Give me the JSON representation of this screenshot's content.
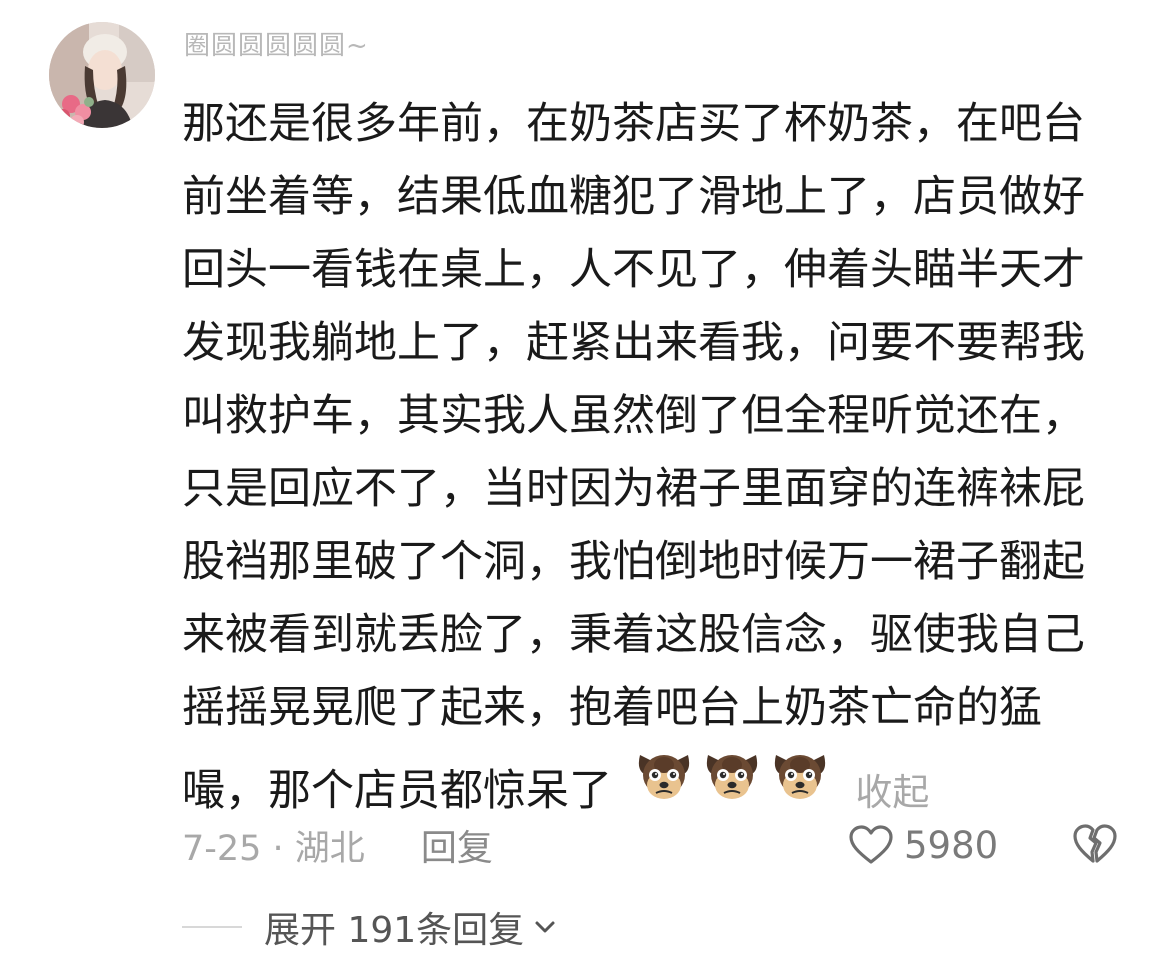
{
  "comment": {
    "username": "圈圆圆圆圆圆~",
    "text_lines": [
      "那还是很多年前，在奶茶店买了杯奶茶，在吧台",
      "前坐着等，结果低血糖犯了滑地上了，店员做好",
      "回头一看钱在桌上，人不见了，伸着头瞄半天才",
      "发现我躺地上了，赶紧出来看我，问要不要帮我",
      "叫救护车，其实我人虽然倒了但全程听觉还在，",
      "只是回应不了，当时因为裙子里面穿的连裤袜屁",
      "股裆那里破了个洞，我怕倒地时候万一裙子翻起",
      "来被看到就丢脸了，秉着这股信念，驱使我自己",
      "摇摇晃晃爬了起来，抱着吧台上奶茶亡命的猛"
    ],
    "last_line": "嘬，那个店员都惊呆了",
    "emojis": [
      "dog-face-emoji",
      "dog-face-emoji",
      "dog-face-emoji"
    ],
    "collapse_label": "收起",
    "date_location": "7-25 · 湖北",
    "reply_label": "回复",
    "like_count": "5980",
    "expand_label": "展开 191条回复"
  },
  "icons": {
    "like": "heart-outline-icon",
    "dislike": "broken-heart-icon",
    "expand": "chevron-down-icon"
  },
  "colors": {
    "text": "#1a1a1a",
    "secondary": "#a8a8a8",
    "background": "#ffffff"
  }
}
